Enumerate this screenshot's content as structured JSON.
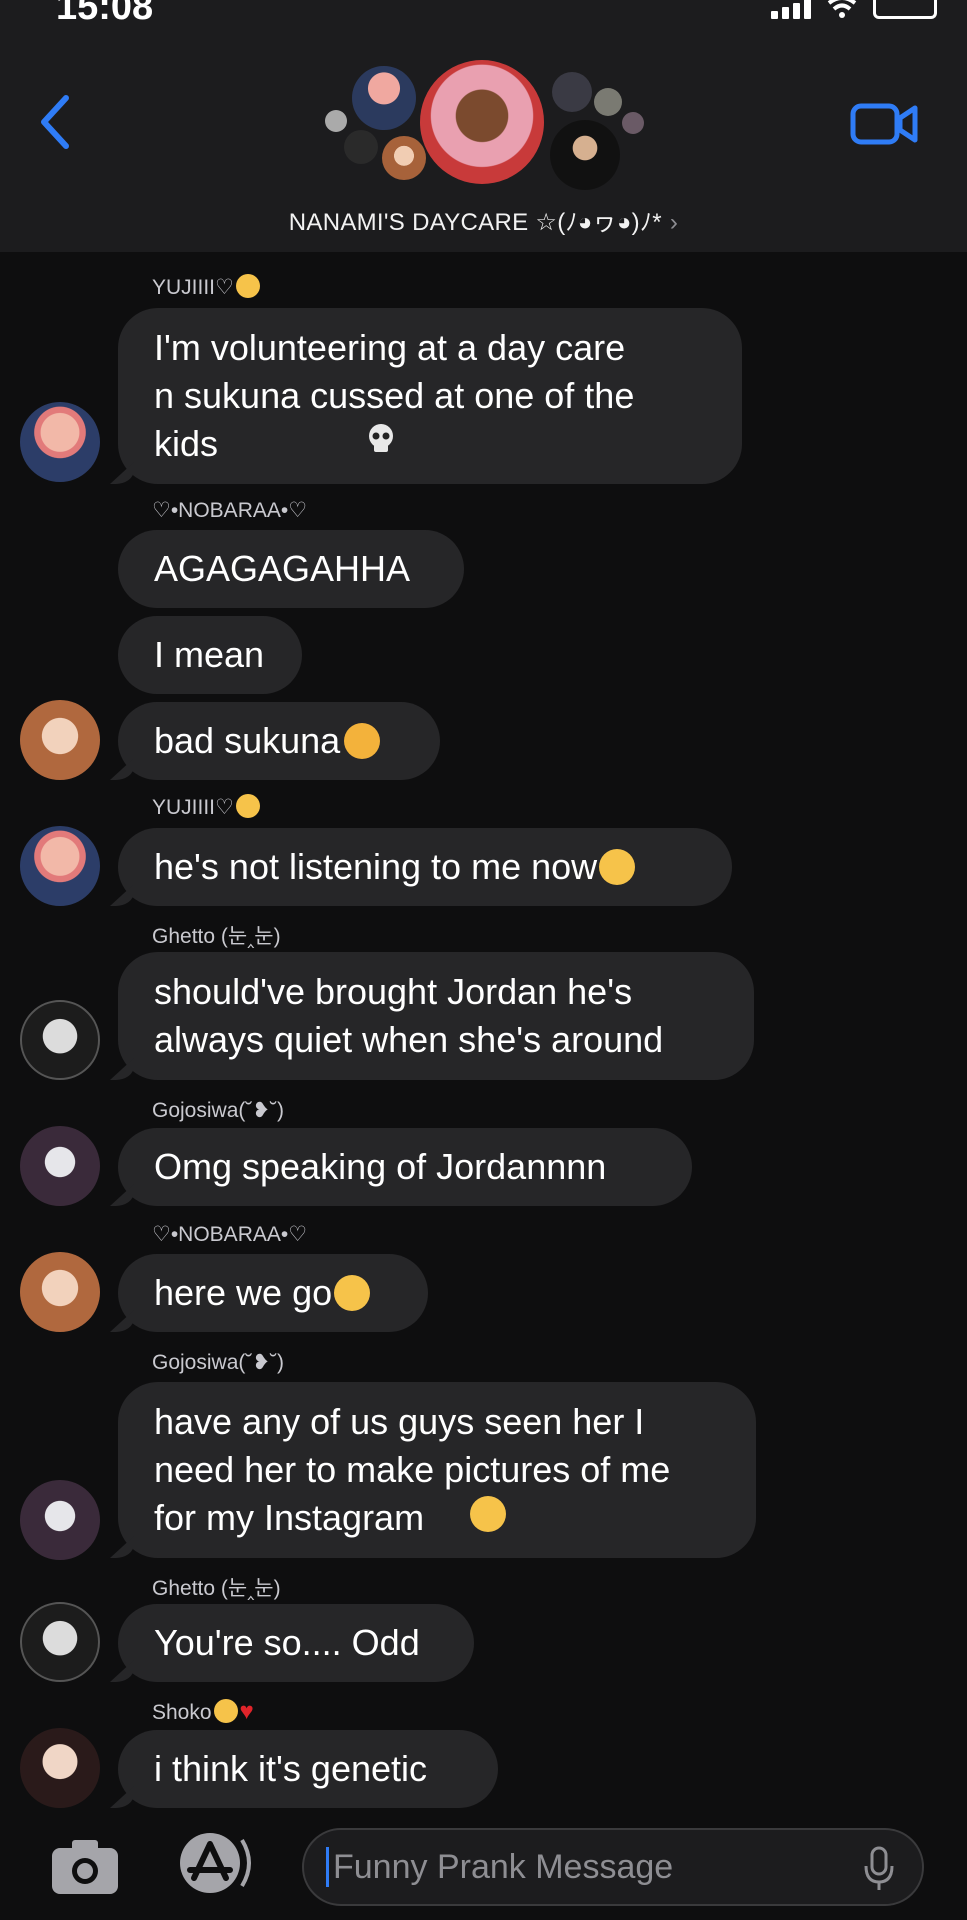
{
  "status_bar": {
    "time": "15:08"
  },
  "header": {
    "group_name": "NANAMI'S DAYCARE ☆(ﾉ◕ヮ◕)ﾉ*",
    "chevron": "›",
    "back_icon": "chevron-left-icon",
    "video_icon": "video-camera-icon"
  },
  "messages": [
    {
      "sender": "YUJIIII♡",
      "lines": "I'm volunteering at a day care\nn sukuna cussed at one of the\nkids",
      "emoji": "skull"
    },
    {
      "sender": "♡•NOBARAA•♡",
      "lines": "AGAGAGAHHA"
    },
    {
      "lines": "I mean"
    },
    {
      "lines": "bad sukuna",
      "emoji": "angry-face"
    },
    {
      "sender": "YUJIIII♡",
      "lines": "he's not listening to me now",
      "emoji": "loudly-crying-face"
    },
    {
      "sender": "Ghetto (눈‸눈)",
      "lines": "should've brought Jordan he's\nalways quiet when she's around"
    },
    {
      "sender": "Gojosiwa(˘❥˘)",
      "lines": "Omg speaking of Jordannnn"
    },
    {
      "sender": "♡•NOBARAA•♡",
      "lines": "here we go",
      "emoji": "unamused-face"
    },
    {
      "sender": "Gojosiwa(˘❥˘)",
      "lines": "have any of us guys seen her I\nneed her to make pictures of me\nfor my Instagram",
      "emoji": "grinning-face"
    },
    {
      "sender": "Ghetto (눈‸눈)",
      "lines": "You're so.... Odd"
    },
    {
      "sender": "Shoko",
      "lines": "i think it's genetic"
    }
  ],
  "composer": {
    "placeholder": "Funny Prank Message",
    "camera_icon": "camera-icon",
    "apps_icon": "app-store-icon",
    "mic_icon": "microphone-icon"
  },
  "colors": {
    "background": "#0e0e0f",
    "header_bg": "#1c1c1e",
    "bubble": "#262628",
    "accent": "#2f7cf6"
  }
}
